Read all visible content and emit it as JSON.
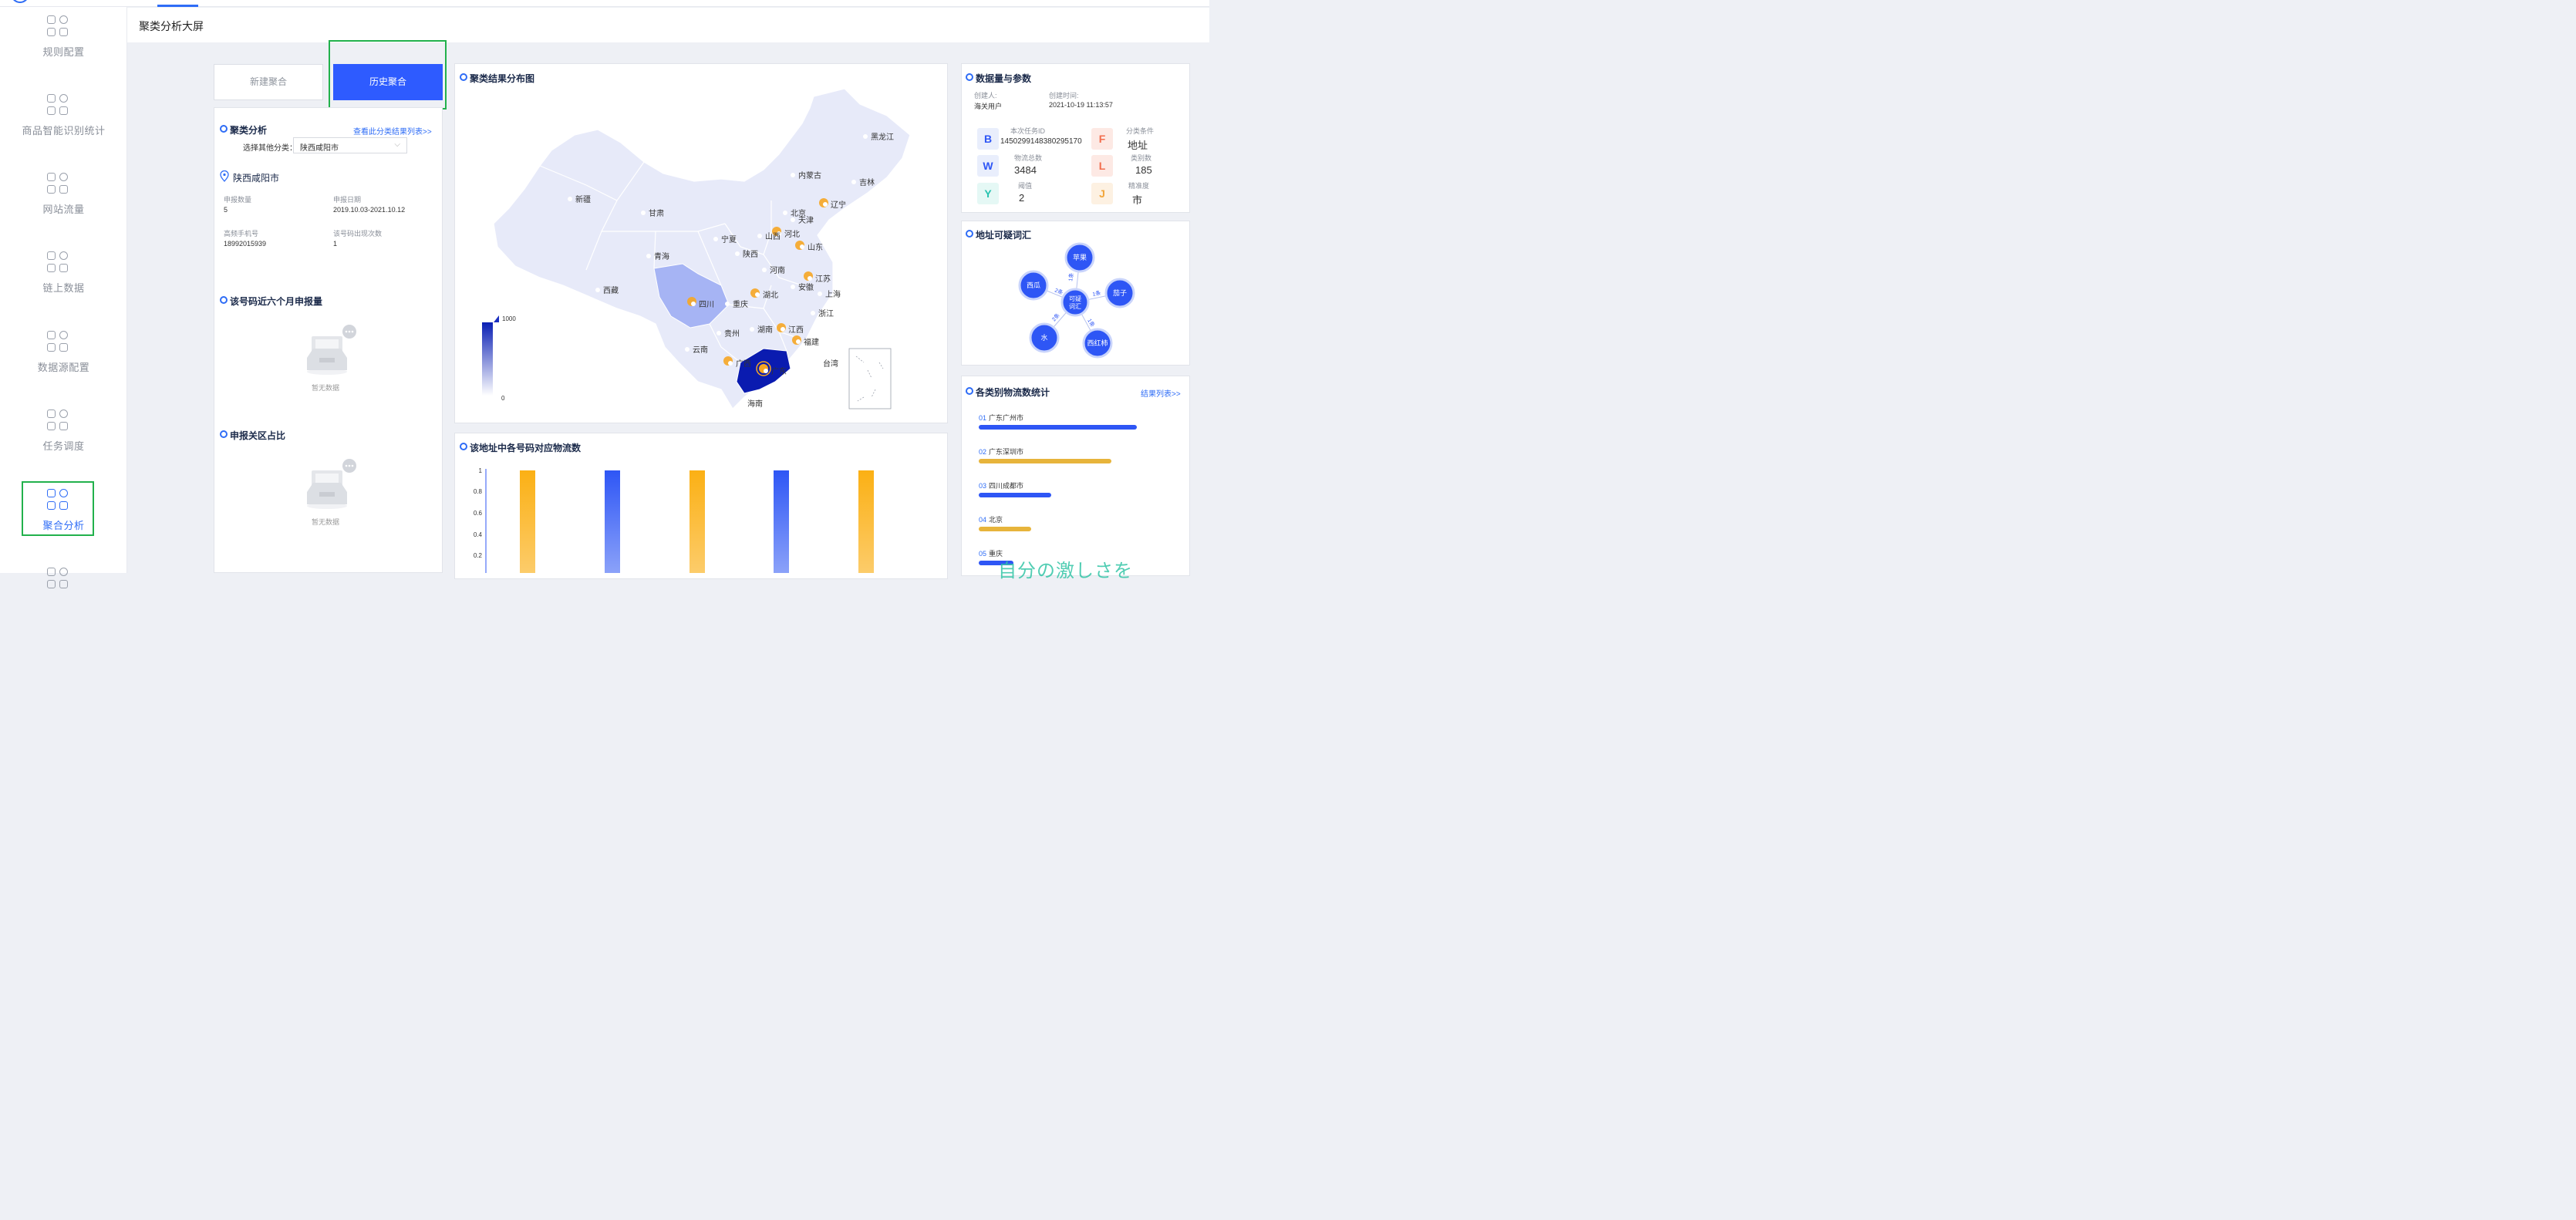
{
  "header": {
    "title": "聚类分析大屏"
  },
  "sidebar": {
    "items": [
      {
        "label": "规则配置"
      },
      {
        "label": "商品智能识别统计"
      },
      {
        "label": "网站流量"
      },
      {
        "label": "链上数据"
      },
      {
        "label": "数据源配置"
      },
      {
        "label": "任务调度"
      },
      {
        "label": "聚合分析"
      }
    ]
  },
  "tabs": {
    "new_label": "新建聚合",
    "history_label": "历史聚合"
  },
  "left": {
    "cluster_title": "聚类分析",
    "view_list_link": "查看此分类结果列表>>",
    "select_label": "选择其他分类：",
    "select_value": "陕西咸阳市",
    "city": "陕西咸阳市",
    "fields": [
      {
        "key": "申报数量",
        "value": "5"
      },
      {
        "key": "申报日期",
        "value": "2019.10.03-2021.10.12"
      },
      {
        "key": "高频手机号",
        "value": "18992015939"
      },
      {
        "key": "该号码出现次数",
        "value": "1"
      }
    ],
    "recent_title": "该号码近六个月申报量",
    "customs_title": "申报关区占比",
    "empty_text": "暂无数据"
  },
  "map": {
    "title": "聚类结果分布图",
    "legend_max": "1000",
    "legend_min": "0",
    "provinces": [
      "黑龙江",
      "吉林",
      "辽宁",
      "内蒙古",
      "北京",
      "天津",
      "河北",
      "山西",
      "山东",
      "新疆",
      "甘肃",
      "宁夏",
      "陕西",
      "青海",
      "河南",
      "江苏",
      "安徽",
      "上海",
      "西藏",
      "四川",
      "重庆",
      "湖北",
      "浙江",
      "湖南",
      "江西",
      "贵州",
      "福建",
      "云南",
      "广西",
      "广东",
      "台湾",
      "海南"
    ]
  },
  "bar": {
    "title": "该地址中各号码对应物流数",
    "y_ticks": [
      "1",
      "0.8",
      "0.6",
      "0.4",
      "0.2"
    ]
  },
  "chart_data": {
    "type": "bar",
    "title": "该地址中各号码对应物流数",
    "ylim": [
      0,
      1
    ],
    "values": [
      1,
      1,
      1,
      1,
      1
    ],
    "colors": [
      "#fbb014",
      "#2e56f5",
      "#fbb014",
      "#2e56f5",
      "#fbb014"
    ]
  },
  "params": {
    "title": "数据量与参数",
    "creator_label": "创建人:",
    "creator": "海关用户",
    "time_label": "创建时间:",
    "time": "2021-10-19 11:13:57",
    "items": [
      {
        "badge": "B",
        "label": "本次任务ID",
        "value": "1450299148380295170"
      },
      {
        "badge": "F",
        "label": "分类条件",
        "value": "地址"
      },
      {
        "badge": "W",
        "label": "物流总数",
        "value": "3484"
      },
      {
        "badge": "L",
        "label": "类别数",
        "value": "185"
      },
      {
        "badge": "Y",
        "label": "阈值",
        "value": "2"
      },
      {
        "badge": "J",
        "label": "精准度",
        "value": "市"
      }
    ]
  },
  "vocab": {
    "title": "地址可疑词汇",
    "center": "可疑词汇",
    "nodes": [
      "苹果",
      "西瓜",
      "茄子",
      "水",
      "西红柿"
    ],
    "edges": [
      "1条",
      "2条",
      "1条",
      "2条",
      "1条"
    ]
  },
  "logistics": {
    "title": "各类别物流数统计",
    "link": "结果列表>>",
    "items": [
      {
        "rank": "01",
        "name": "广东广州市",
        "ratio": 1.0,
        "color": "#2e56f5"
      },
      {
        "rank": "02",
        "name": "广东深圳市",
        "ratio": 0.84,
        "color": "#e7b43b"
      },
      {
        "rank": "03",
        "name": "四川成都市",
        "ratio": 0.46,
        "color": "#2e56f5"
      },
      {
        "rank": "04",
        "name": "北京",
        "ratio": 0.33,
        "color": "#e7b43b"
      },
      {
        "rank": "05",
        "name": "重庆",
        "ratio": 0.22,
        "color": "#2e56f5"
      }
    ]
  },
  "watermark": "自分の激しさを"
}
